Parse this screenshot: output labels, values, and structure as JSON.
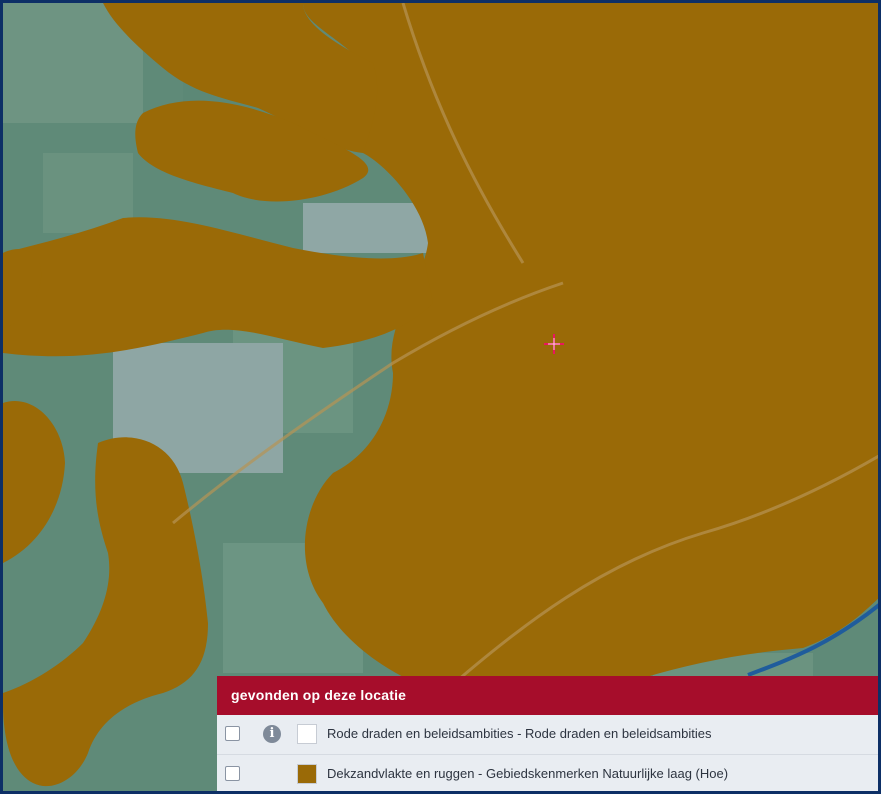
{
  "map": {
    "base_color": "#5f8a78",
    "overlay_color": "#9a6a07",
    "crosshair_color": "#e8175d"
  },
  "legend": {
    "title": "gevonden op deze locatie",
    "header_color": "#a60d2b",
    "items": [
      {
        "label": "Rode draden en beleidsambities - Rode draden en beleidsambities",
        "swatch_color": "#ffffff",
        "checked": false,
        "has_info": true,
        "info_glyph": "i"
      },
      {
        "label": "Dekzandvlakte en ruggen - Gebiedskenmerken Natuurlijke laag (Hoe)",
        "swatch_color": "#9a6a07",
        "checked": false,
        "has_info": false
      }
    ]
  }
}
